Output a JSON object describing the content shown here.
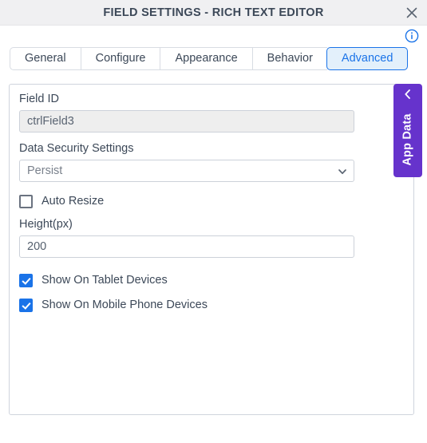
{
  "titlebar": {
    "title": "FIELD SETTINGS - RICH TEXT EDITOR",
    "close_label": "×",
    "close_icon": "close-icon"
  },
  "header": {
    "info_icon": "info-circle-icon"
  },
  "tabs": {
    "items": [
      {
        "label": "General",
        "active": false
      },
      {
        "label": "Configure",
        "active": false
      },
      {
        "label": "Appearance",
        "active": false
      },
      {
        "label": "Behavior",
        "active": false
      },
      {
        "label": "Advanced",
        "active": true
      }
    ],
    "active_label": "Advanced"
  },
  "form": {
    "field_id": {
      "label": "Field ID",
      "value": "ctrlField3",
      "disabled": true
    },
    "data_security": {
      "label": "Data Security Settings",
      "value": "Persist",
      "options": [
        "Persist"
      ],
      "chevron_icon": "chevron-down-icon"
    },
    "auto_resize": {
      "label": "Auto Resize",
      "checked": false
    },
    "height": {
      "label": "Height(px)",
      "value": "200"
    },
    "show_tablet": {
      "label": "Show On Tablet Devices",
      "checked": true
    },
    "show_mobile": {
      "label": "Show On Mobile Phone Devices",
      "checked": true
    }
  },
  "app_data_tab": {
    "label": "App Data",
    "chevron_icon": "chevron-left-icon"
  },
  "colors": {
    "accent_blue": "#1a73e8",
    "purple": "#6633cc",
    "titlebar_bg": "#f0f0f2",
    "text": "#3c4858"
  }
}
